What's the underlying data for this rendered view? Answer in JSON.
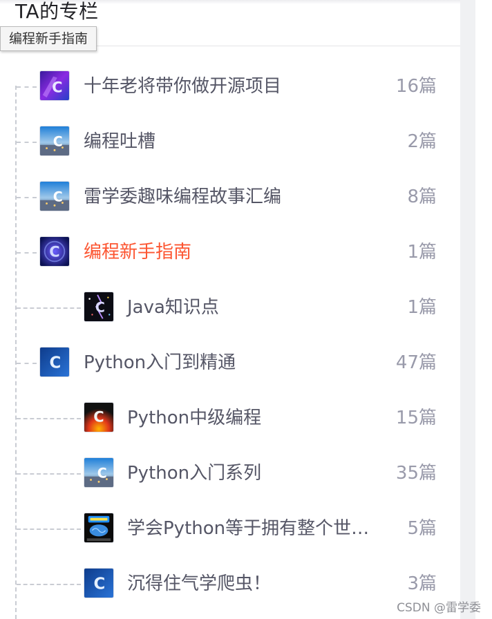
{
  "header": {
    "title": "TA的专栏"
  },
  "tooltip": {
    "text": "编程新手指南"
  },
  "columns": [
    {
      "name": "十年老将带你做开源项目",
      "count": "16篇",
      "level": 1,
      "active": false,
      "thumb_icon": "purple-c-logo"
    },
    {
      "name": "编程吐槽",
      "count": "2篇",
      "level": 1,
      "active": false,
      "thumb_icon": "city-c-logo"
    },
    {
      "name": "雷学委趣味编程故事汇编",
      "count": "8篇",
      "level": 1,
      "active": false,
      "thumb_icon": "city-c-logo"
    },
    {
      "name": "编程新手指南",
      "count": "1篇",
      "level": 1,
      "active": true,
      "thumb_icon": "galaxy-c-logo"
    },
    {
      "name": "Java知识点",
      "count": "1篇",
      "level": 2,
      "active": false,
      "thumb_icon": "lightning-c-logo"
    },
    {
      "name": "Python入门到精通",
      "count": "47篇",
      "level": 1,
      "active": false,
      "thumb_icon": "blue-c-logo"
    },
    {
      "name": "Python中级编程",
      "count": "15篇",
      "level": 2,
      "active": false,
      "thumb_icon": "fire-c-logo"
    },
    {
      "name": "Python入门系列",
      "count": "35篇",
      "level": 2,
      "active": false,
      "thumb_icon": "city-c-logo"
    },
    {
      "name": "学会Python等于拥有整个世…",
      "count": "5篇",
      "level": 2,
      "active": false,
      "thumb_icon": "brain-logo"
    },
    {
      "name": "沉得住气学爬虫！",
      "count": "3篇",
      "level": 2,
      "active": false,
      "thumb_icon": "blue-c-logo"
    }
  ],
  "colors": {
    "active": "#fc5531",
    "text": "#555666",
    "count": "#999aaa",
    "tree_line": "#c9ccd3"
  },
  "watermark": "CSDN @雷学委"
}
